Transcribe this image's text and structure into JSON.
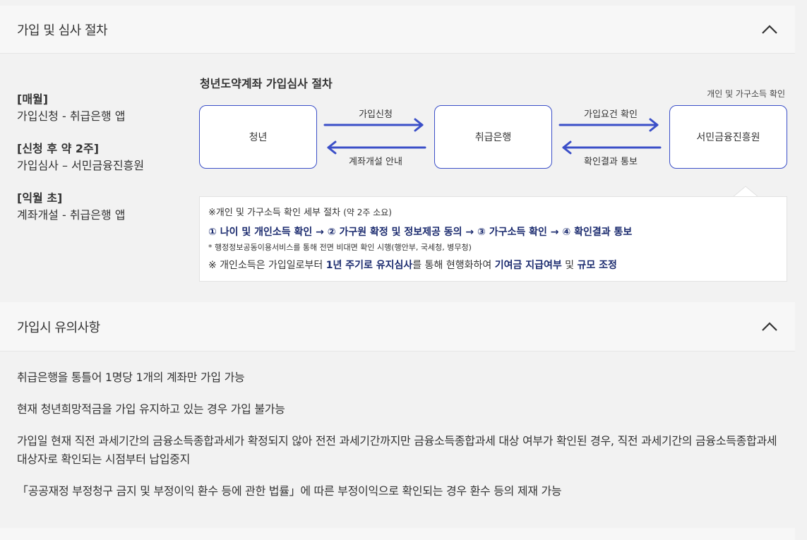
{
  "section1": {
    "title": "가입 및 심사 절차",
    "steps": [
      {
        "label": "[매월]",
        "desc": "가입신청 - 취급은행 앱"
      },
      {
        "label": "[신청 후 약 2주]",
        "desc": "가입심사 – 서민금융진흥원"
      },
      {
        "label": "[익월 초]",
        "desc": "계좌개설 - 취급은행 앱"
      }
    ],
    "flow": {
      "title": "청년도약계좌 가입심사 절차",
      "side_note": "개인 및 가구소득 확인",
      "boxes": [
        "청년",
        "취급은행",
        "서민금융진흥원"
      ],
      "arrows": {
        "a1_top": "가입신청",
        "a1_bottom": "계좌개설 안내",
        "a2_top": "가입요건 확인",
        "a2_bottom": "확인결과 통보"
      },
      "detail": {
        "line1_main": "※개인 및 가구소득 확인 세부 절차",
        "line1_small": "(약 2주 소요)",
        "line2": "① 나이 및 개인소득 확인 → ② 가구원 확정 및 정보제공 동의 → ③ 가구소득 확인 → ④ 확인결과 통보",
        "line3": "* 행정정보공동이용서비스를 통해 전면 비대면 확인 시행(행안부, 국세청, 병무청)",
        "line4_a": "※ 개인소득은 가입일로부터 ",
        "line4_b": "1년 주기로 유지심사",
        "line4_c": "를 통해 현행화하여 ",
        "line4_d": "기여금 지급여부",
        "line4_e": " 및 ",
        "line4_f": "규모 조정"
      }
    }
  },
  "section2": {
    "title": "가입시 유의사항",
    "notes": [
      "취급은행을 통틀어 1명당 1개의 계좌만 가입 가능",
      "현재 청년희망적금을 가입 유지하고 있는 경우 가입 불가능",
      "가입일 현재 직전 과세기간의 금융소득종합과세가 확정되지 않아 전전 과세기간까지만 금융소득종합과세 대상 여부가 확인된 경우, 직전 과세기간의 금융소득종합과세 대상자로 확인되는 시점부터 납입중지",
      "「공공재정 부정청구 금지 및 부정이익 환수 등에 관한 법률」에 따른 부정이익으로 확인되는 경우 환수 등의 제재 가능"
    ]
  },
  "colors": {
    "accent": "#3b4fc8",
    "highlight_text": "#1a2a6e"
  },
  "icons": {
    "collapse": "chevron-up-icon",
    "arrow_right": "arrow-right-icon",
    "arrow_left": "arrow-left-icon"
  }
}
